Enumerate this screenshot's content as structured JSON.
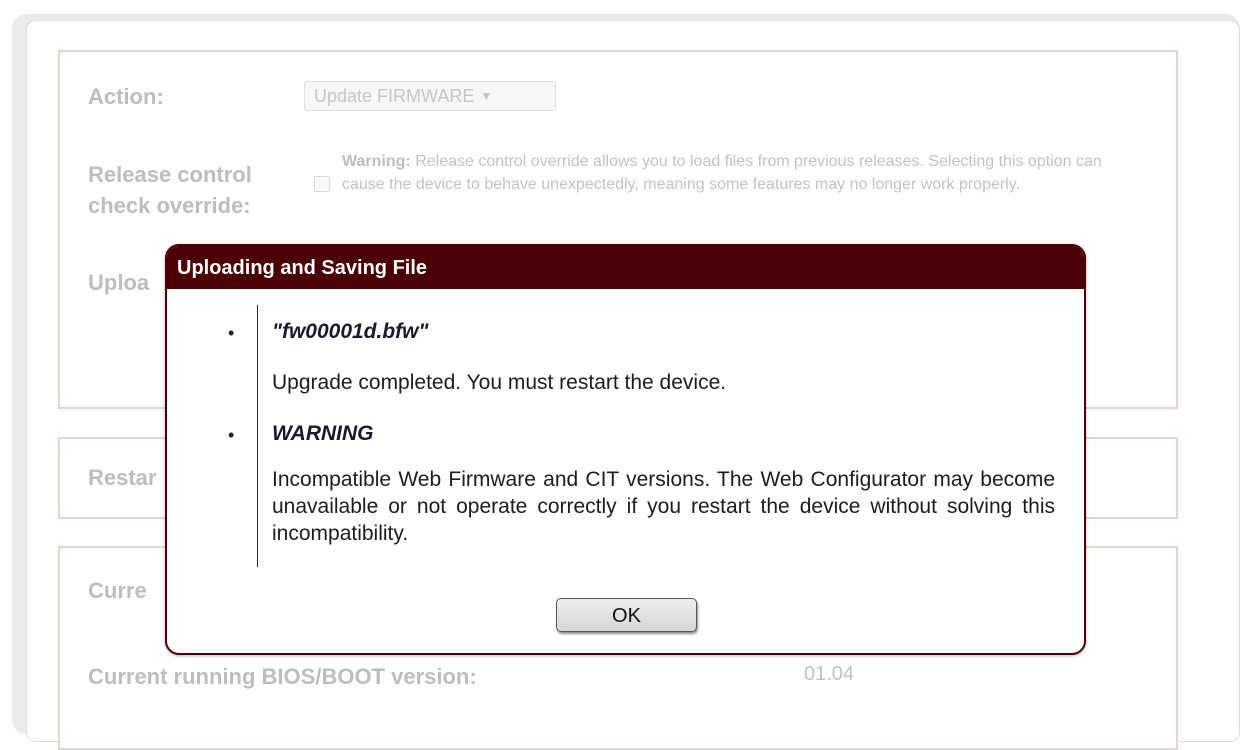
{
  "form": {
    "action_label": "Action:",
    "action_value": "Update FIRMWARE",
    "release_label_line1": "Release control",
    "release_label_line2": "check override:",
    "warning_prefix": "Warning:",
    "warning_text": "Release control override allows you to load files from previous releases. Selecting this option can cause the device to behave unexpectedly, meaning some features may no longer work properly.",
    "upload_label_partial": "Uploa",
    "restart_label_partial": "Restar",
    "current_label_partial": "Curre",
    "bios_label": "Current running BIOS/BOOT version:",
    "bios_value": "01.04"
  },
  "modal": {
    "title": "Uploading and Saving File",
    "file_name": "\"fw00001d.bfw\"",
    "file_message": "Upgrade completed. You must restart the device.",
    "warning_title": "WARNING",
    "warning_message": "Incompatible Web Firmware and CIT versions. The Web Configurator may become unavailable or not operate correctly if you restart the device without solving this incompatibility.",
    "bullet": "•",
    "ok_label": "OK"
  },
  "icons": {
    "dropdown": "chevron-down-icon"
  }
}
